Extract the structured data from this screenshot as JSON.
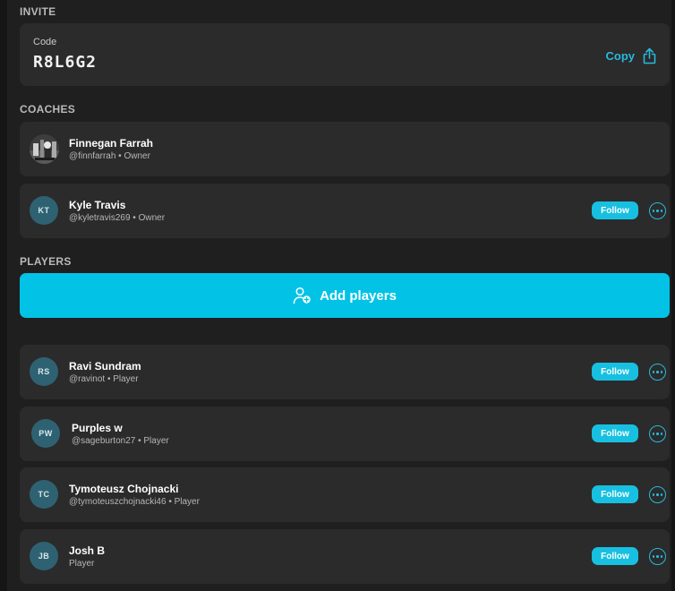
{
  "invite": {
    "section_title": "INVITE",
    "code_label": "Code",
    "code_value": "R8L6G2",
    "copy_label": "Copy",
    "copy_icon": "share-icon"
  },
  "coaches": {
    "section_title": "COACHES",
    "items": [
      {
        "name": "Finnegan Farrah",
        "handle": "@finnfarrah • Owner",
        "avatar": "photo"
      },
      {
        "name": "Kyle Travis",
        "handle": "@kyletravis269 • Owner",
        "initials": "KT",
        "follow_label": "Follow"
      }
    ]
  },
  "players": {
    "section_title": "PLAYERS",
    "add_label": "Add players",
    "items": [
      {
        "name": "Ravi Sundram",
        "handle": "@ravinot • Player",
        "initials": "RS",
        "follow_label": "Follow"
      },
      {
        "name": "Purples w",
        "handle": "@sageburton27 • Player",
        "initials": "PW",
        "follow_label": "Follow"
      },
      {
        "name": "Tymoteusz Chojnacki",
        "handle": "@tymoteuszchojnacki46 • Player",
        "initials": "TC",
        "follow_label": "Follow"
      },
      {
        "name": "Josh B",
        "handle": "Player",
        "initials": "JB",
        "follow_label": "Follow"
      }
    ]
  },
  "colors": {
    "accent": "#02c3e6",
    "card": "#2b2b2b",
    "background": "#1f1f1f",
    "avatar": "#2e6272"
  }
}
